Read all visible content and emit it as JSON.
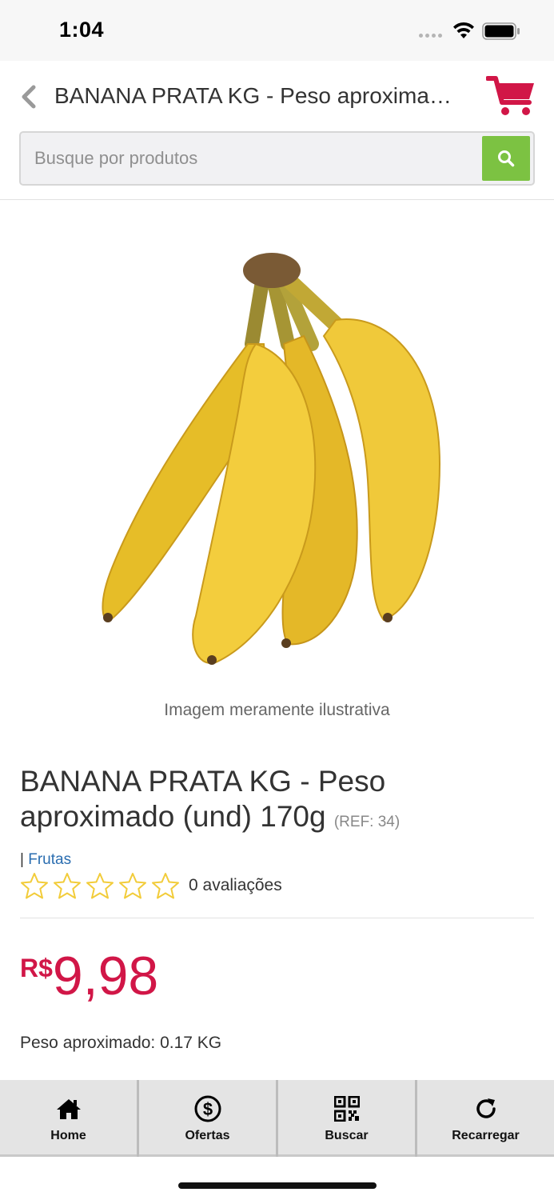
{
  "status_bar": {
    "time": "1:04"
  },
  "header": {
    "title": "BANANA PRATA KG - Peso aproximado (und) 170g",
    "cart_color": "#d11647"
  },
  "search": {
    "placeholder": "Busque por produtos",
    "value": "",
    "button_color": "#7cc242"
  },
  "product": {
    "image_caption": "Imagem meramente ilustrativa",
    "title": "BANANA PRATA KG - Peso aproximado (und) 170g",
    "ref": "(REF: 34)",
    "category_prefix": "| ",
    "category": "Frutas",
    "rating_stars": 0,
    "rating_max": 5,
    "reviews_label": "0 avaliações",
    "price_currency": "R$",
    "price_value": "9,98",
    "price_color": "#d11647",
    "weight_label": "Peso aproximado: 0.17 KG"
  },
  "tabs": [
    {
      "label": "Home",
      "icon": "home-icon"
    },
    {
      "label": "Ofertas",
      "icon": "dollar-circle-icon"
    },
    {
      "label": "Buscar",
      "icon": "qr-code-icon"
    },
    {
      "label": "Recarregar",
      "icon": "refresh-icon"
    }
  ]
}
